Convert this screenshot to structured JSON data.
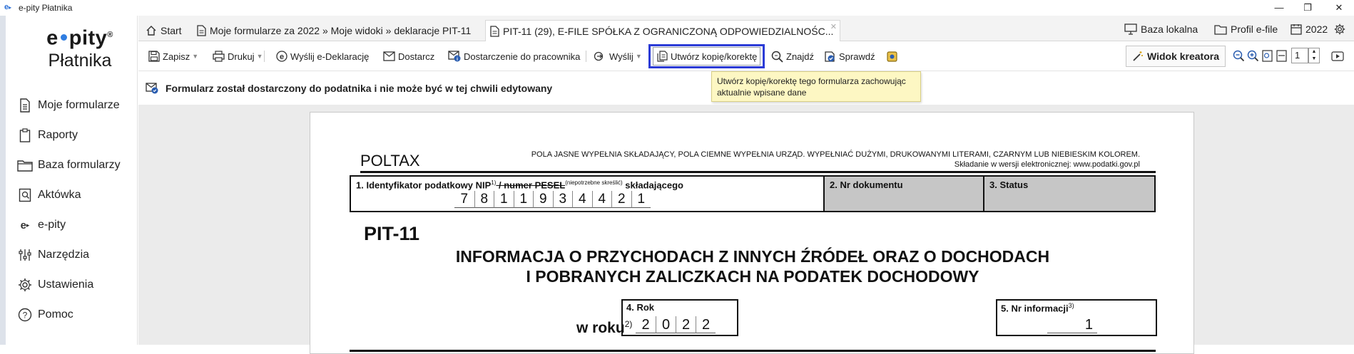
{
  "window": {
    "title": "e-pity Płatnika",
    "app_icon": "e-pity-icon"
  },
  "sidebar": {
    "logo_line1_a": "e",
    "logo_line1_b": "pity",
    "logo_mark": "®",
    "logo_line2": "Płatnika",
    "items": [
      {
        "label": "Moje formularze",
        "icon": "document-icon"
      },
      {
        "label": "Raporty",
        "icon": "clipboard-icon"
      },
      {
        "label": "Baza formularzy",
        "icon": "folder-icon"
      },
      {
        "label": "Aktówka",
        "icon": "briefcase-icon"
      },
      {
        "label": "e-pity",
        "icon": "e-pity-icon"
      },
      {
        "label": "Narzędzia",
        "icon": "tools-icon"
      },
      {
        "label": "Ustawienia",
        "icon": "gear-icon"
      },
      {
        "label": "Pomoc",
        "icon": "help-icon"
      }
    ]
  },
  "tabs": {
    "start": "Start",
    "forms": "Moje formularze za 2022 » Moje widoki » deklaracje PIT-11",
    "active": "PIT-11 (29), E-FILE SPÓŁKA Z OGRANICZONĄ ODPOWIEDZIALNOŚC...",
    "baza_lokalna": "Baza lokalna",
    "profil": "Profil e-file",
    "year": "2022"
  },
  "toolbar": {
    "zapisz": "Zapisz",
    "drukuj": "Drukuj",
    "wyslij_edeklaracje": "Wyślij e-Deklarację",
    "dostarcz": "Dostarcz",
    "dostarczenie": "Dostarczenie do pracownika",
    "wyslij": "Wyślij",
    "utworz_kopie": "Utwórz kopię/korektę",
    "znajdz": "Znajdź",
    "sprawdz": "Sprawdź",
    "widok_kreatora": "Widok kreatora",
    "page_value": "1"
  },
  "infobar": {
    "message": "Formularz został dostarczony do podatnika i nie może być w tej chwili edytowany"
  },
  "tooltip": {
    "text": "Utwórz kopię/korektę tego formularza zachowując aktualnie wpisane dane"
  },
  "form": {
    "poltax": "POLTAX",
    "note_line1": "POLA JASNE WYPEŁNIA SKŁADAJĄCY, POLA CIEMNE WYPEŁNIA URZĄD. WYPEŁNIAĆ DUŻYMI, DRUKOWANYMI LITERAMI, CZARNYM LUB NIEBIESKIM KOLOREM.",
    "note_line2": "Składanie w wersji elektronicznej: www.podatki.gov.pl",
    "field1_label_a": "1. Identyfikator podatkowy NIP",
    "field1_sup1": "1)",
    "field1_label_b": " / numer PESEL",
    "field1_sup2": "(niepotrzebne skreślić)",
    "field1_label_c": " składającego",
    "nip_digits": [
      "7",
      "8",
      "1",
      "1",
      "9",
      "3",
      "4",
      "4",
      "2",
      "1"
    ],
    "field2_label": "2. Nr dokumentu",
    "field3_label": "3. Status",
    "pit_title": "PIT-11",
    "main_title_line1": "INFORMACJA O PRZYCHODACH Z INNYCH ŹRÓDEŁ ORAZ O DOCHODACH",
    "main_title_line2": "I POBRANYCH ZALICZKACH NA PODATEK DOCHODOWY",
    "w_roku": "w roku",
    "w_roku_sup": "2)",
    "field4_label": "4. Rok",
    "year_digits": [
      "2",
      "0",
      "2",
      "2"
    ],
    "field5_label": "5. Nr informacji",
    "field5_sup": "3)",
    "field5_value": "1"
  },
  "colors": {
    "highlight_border": "#2b3bd6",
    "tooltip_bg": "#fdf7c3",
    "dark_field": "#c6c6c6",
    "logo_dot": "#2f7de1"
  }
}
